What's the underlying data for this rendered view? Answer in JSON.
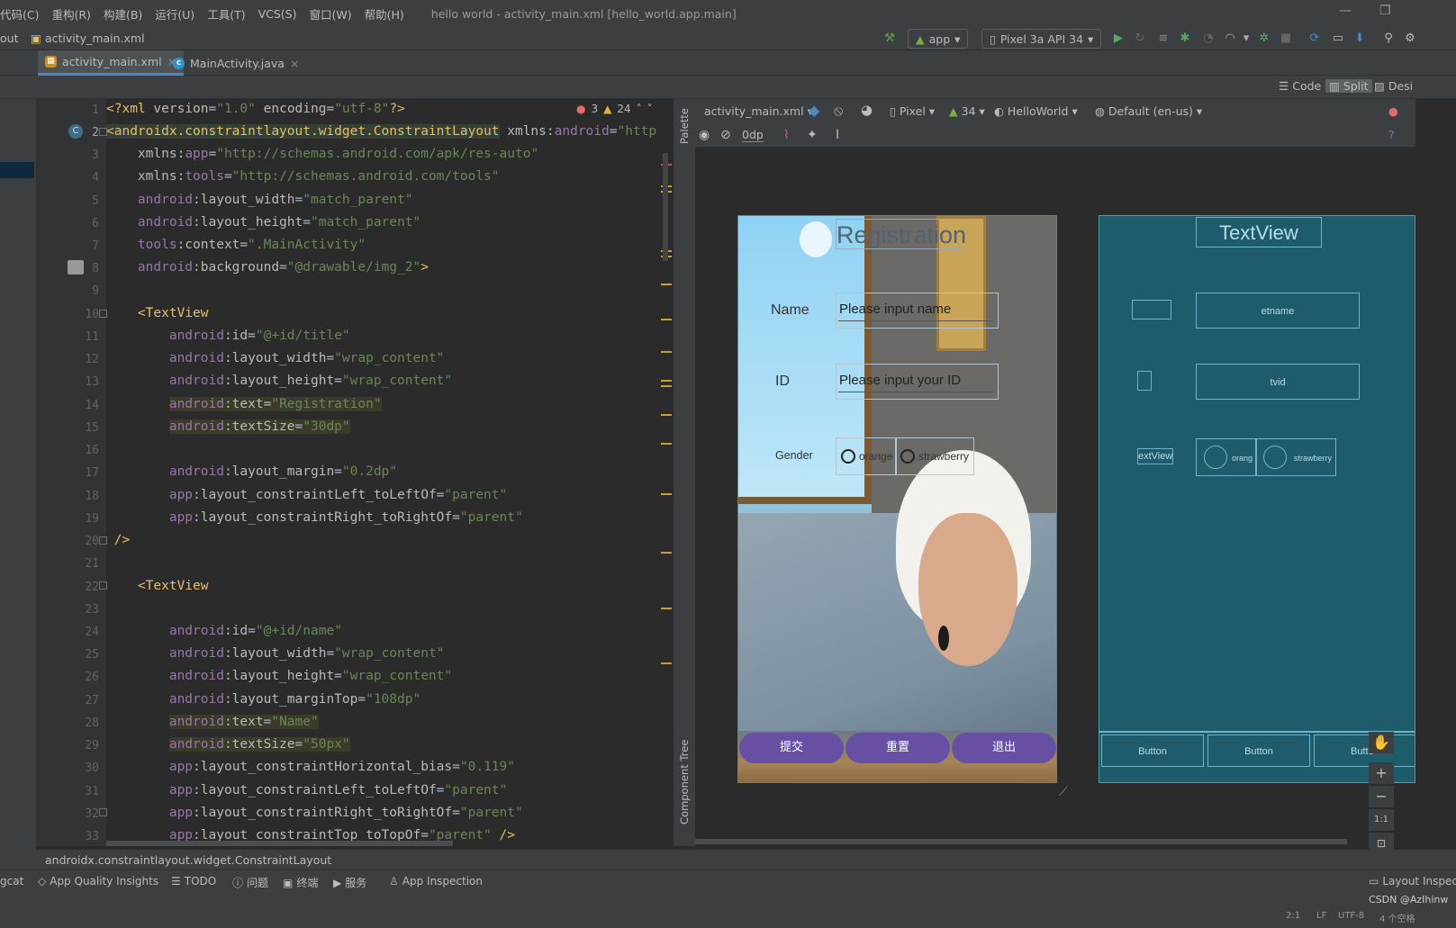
{
  "menubar": {
    "items": [
      "代码(C)",
      "重构(R)",
      "构建(B)",
      "运行(U)",
      "工具(T)",
      "VCS(S)",
      "窗口(W)",
      "帮助(H)"
    ],
    "window_title": "hello world - activity_main.xml [hello_world.app.main]"
  },
  "navbar": {
    "crumb_prefix": "out",
    "crumb_file": "activity_main.xml",
    "run_config": "app",
    "device": "Pixel 3a API 34"
  },
  "tabs": [
    {
      "label": "activity_main.xml",
      "active": true
    },
    {
      "label": "MainActivity.java",
      "active": false
    }
  ],
  "view_modes": {
    "code": "Code",
    "split": "Split",
    "design": "Desi"
  },
  "editor": {
    "error_count": "3",
    "warning_count": "24",
    "line_numbers": [
      "1",
      "2",
      "3",
      "4",
      "5",
      "6",
      "7",
      "8",
      "9",
      "10",
      "11",
      "12",
      "13",
      "14",
      "15",
      "16",
      "17",
      "18",
      "19",
      "20",
      "21",
      "22",
      "23",
      "24",
      "25",
      "26",
      "27",
      "28",
      "29",
      "30",
      "31",
      "32",
      "33"
    ]
  },
  "design_toolbar": {
    "file": "activity_main.xml",
    "margin": "0dp",
    "device": "Pixel",
    "api": "34",
    "theme": "HelloWorld",
    "locale": "Default (en-us)"
  },
  "side_tabs": {
    "palette": "Palette",
    "component_tree": "Component Tree"
  },
  "phone": {
    "title": "Registration",
    "name_label": "Name",
    "name_hint": "Please input name",
    "id_label": "ID",
    "id_hint": "Please input your ID",
    "gender_label": "Gender",
    "radio_orange": "orange",
    "radio_strawberry": "strawberry",
    "btn_submit": "提交",
    "btn_reset": "重置",
    "btn_exit": "退出"
  },
  "blueprint": {
    "title": "TextView",
    "etname": "etname",
    "tvid": "tvid",
    "gender": "extView",
    "orange": "orang",
    "strawberry": "strawberry",
    "button": "Button",
    "button_cut": "Butto"
  },
  "zoom": {
    "fit": "1:1"
  },
  "status_path": "androidx.constraintlayout.widget.ConstraintLayout",
  "bottom_tools": [
    "gcat",
    "App Quality Insights",
    "TODO",
    "问题",
    "终端",
    "服务",
    "App Inspection"
  ],
  "bottom_right": "Layout Inspector",
  "watermark": "CSDN @AzIhinw",
  "footer_status": [
    "2:1",
    "LF",
    "UTF-8",
    "4 个空格"
  ]
}
